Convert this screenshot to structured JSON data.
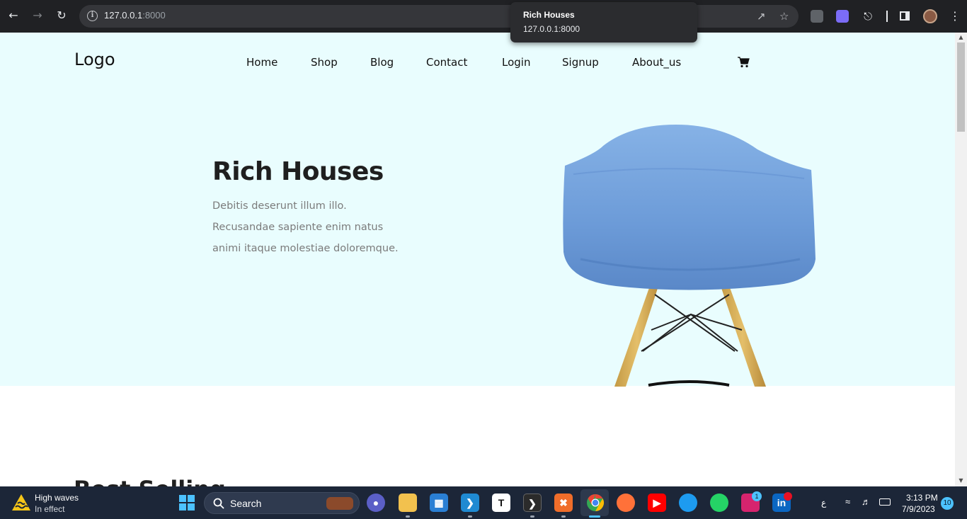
{
  "browser": {
    "url_host": "127.0.0.1",
    "url_port": ":8000",
    "tooltip_title": "Rich Houses",
    "tooltip_url": "127.0.0.1:8000"
  },
  "site": {
    "logo": "Logo",
    "menu": [
      "Home",
      "Shop",
      "Blog",
      "Contact",
      "Login",
      "Signup",
      "About_us"
    ],
    "hero": {
      "title": "Rich Houses",
      "lines": [
        "Debitis deserunt illum illo.",
        "Recusandae sapiente enim natus",
        "animi itaque molestiae doloremque."
      ]
    },
    "next_section_peek": "Best Selling"
  },
  "taskbar": {
    "weather_title": "High waves",
    "weather_sub": "In effect",
    "search_label": "Search",
    "instagram_badge": "1",
    "lang": "ع",
    "time": "3:13 PM",
    "date": "7/9/2023",
    "notifications": "10"
  },
  "colors": {
    "hero_bg": "#e9fdfe",
    "chrome_bg": "#202124",
    "taskbar_bg": "#1c2638",
    "chair_blue": "#7aa8e0"
  }
}
